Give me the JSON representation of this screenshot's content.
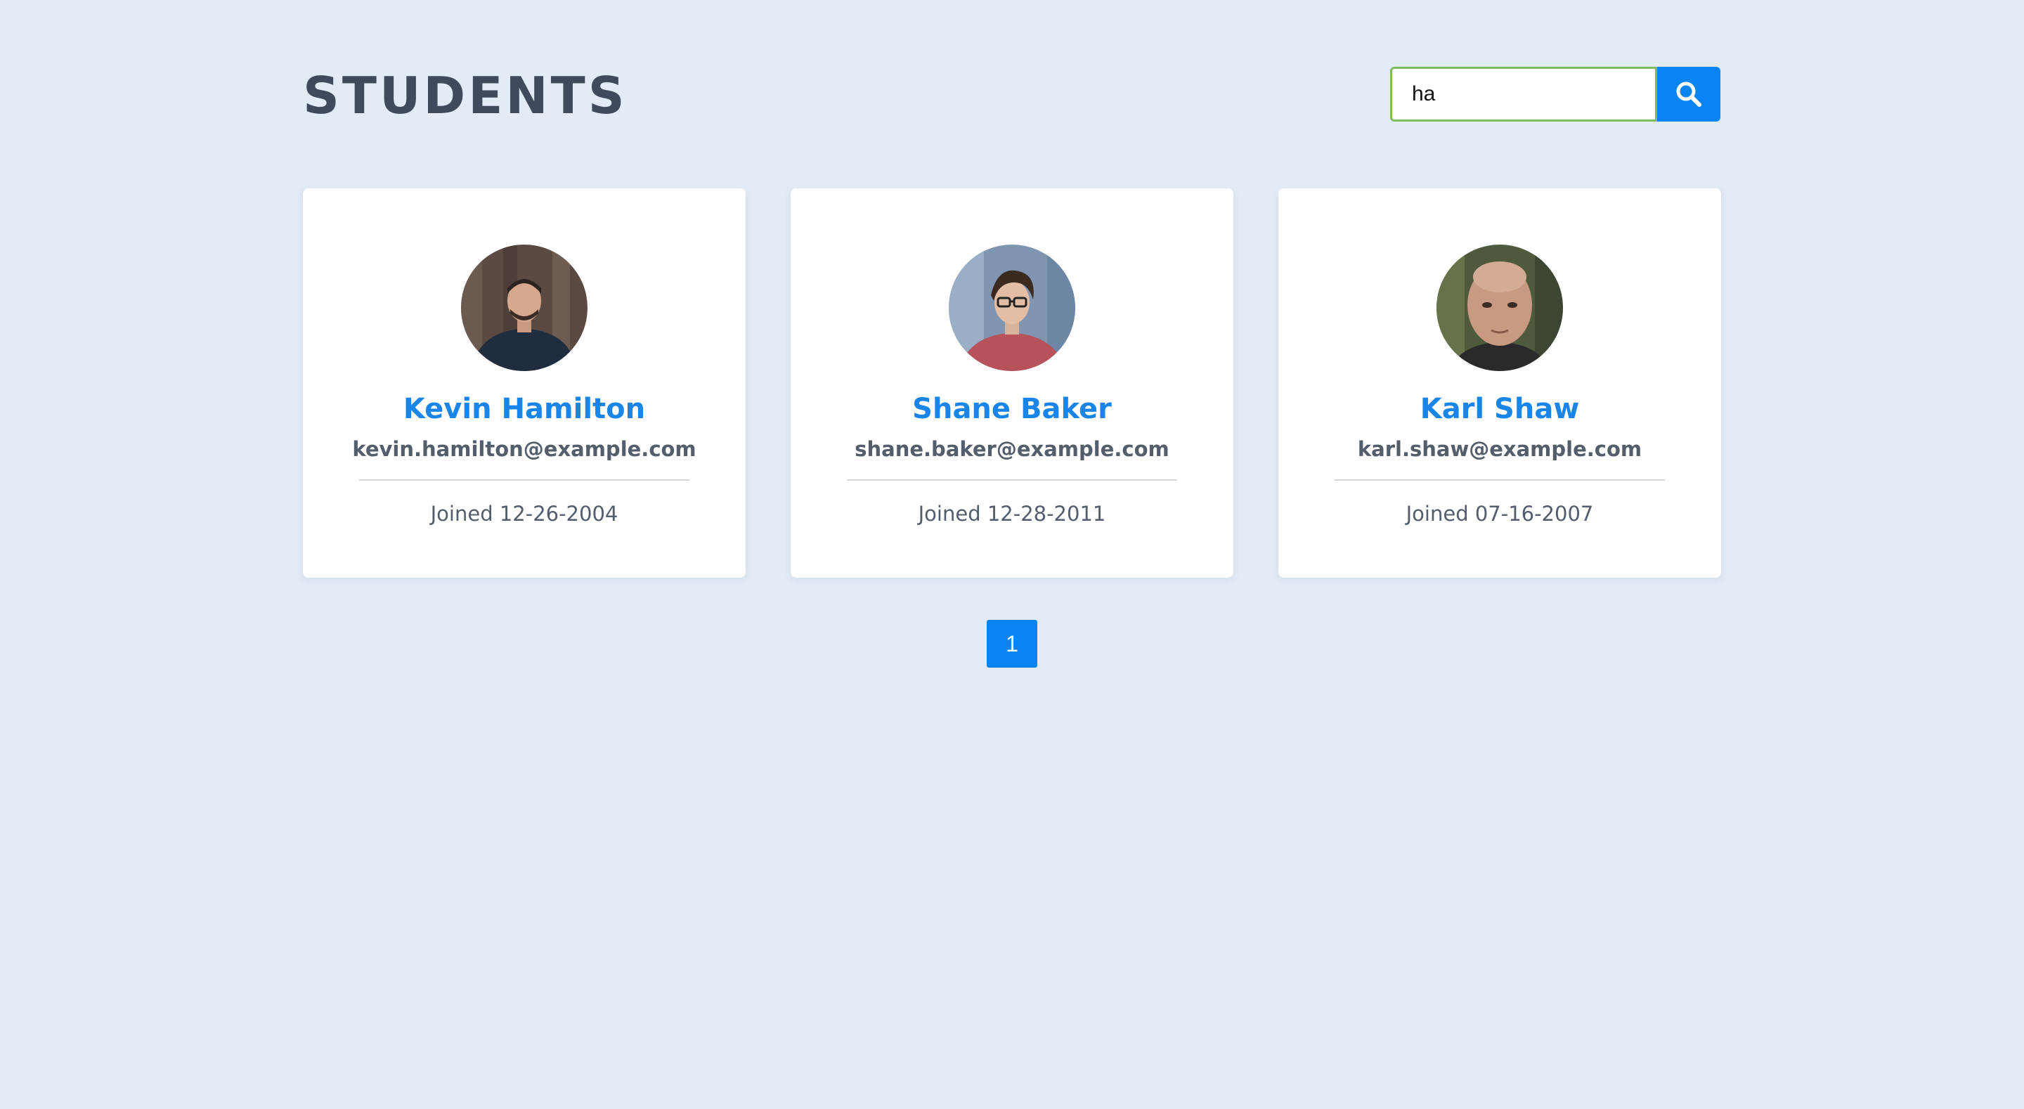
{
  "header": {
    "title": "STUDENTS"
  },
  "search": {
    "value": "ha",
    "placeholder": "",
    "border_color": "#7dbd5f",
    "button_icon": "search-icon",
    "button_color": "#0a84f4"
  },
  "students": [
    {
      "name": "Kevin Hamilton",
      "email": "kevin.hamilton@example.com",
      "joined": "Joined 12-26-2004",
      "avatar": "avatar-photo"
    },
    {
      "name": "Shane Baker",
      "email": "shane.baker@example.com",
      "joined": "Joined 12-28-2011",
      "avatar": "avatar-photo"
    },
    {
      "name": "Karl Shaw",
      "email": "karl.shaw@example.com",
      "joined": "Joined 07-16-2007",
      "avatar": "avatar-photo"
    }
  ],
  "pagination": {
    "pages": [
      "1"
    ],
    "active": "1"
  },
  "colors": {
    "background": "#e2ecf7",
    "accent": "#0a84f4",
    "name": "#1a85e8",
    "title": "#3f4a5c"
  }
}
